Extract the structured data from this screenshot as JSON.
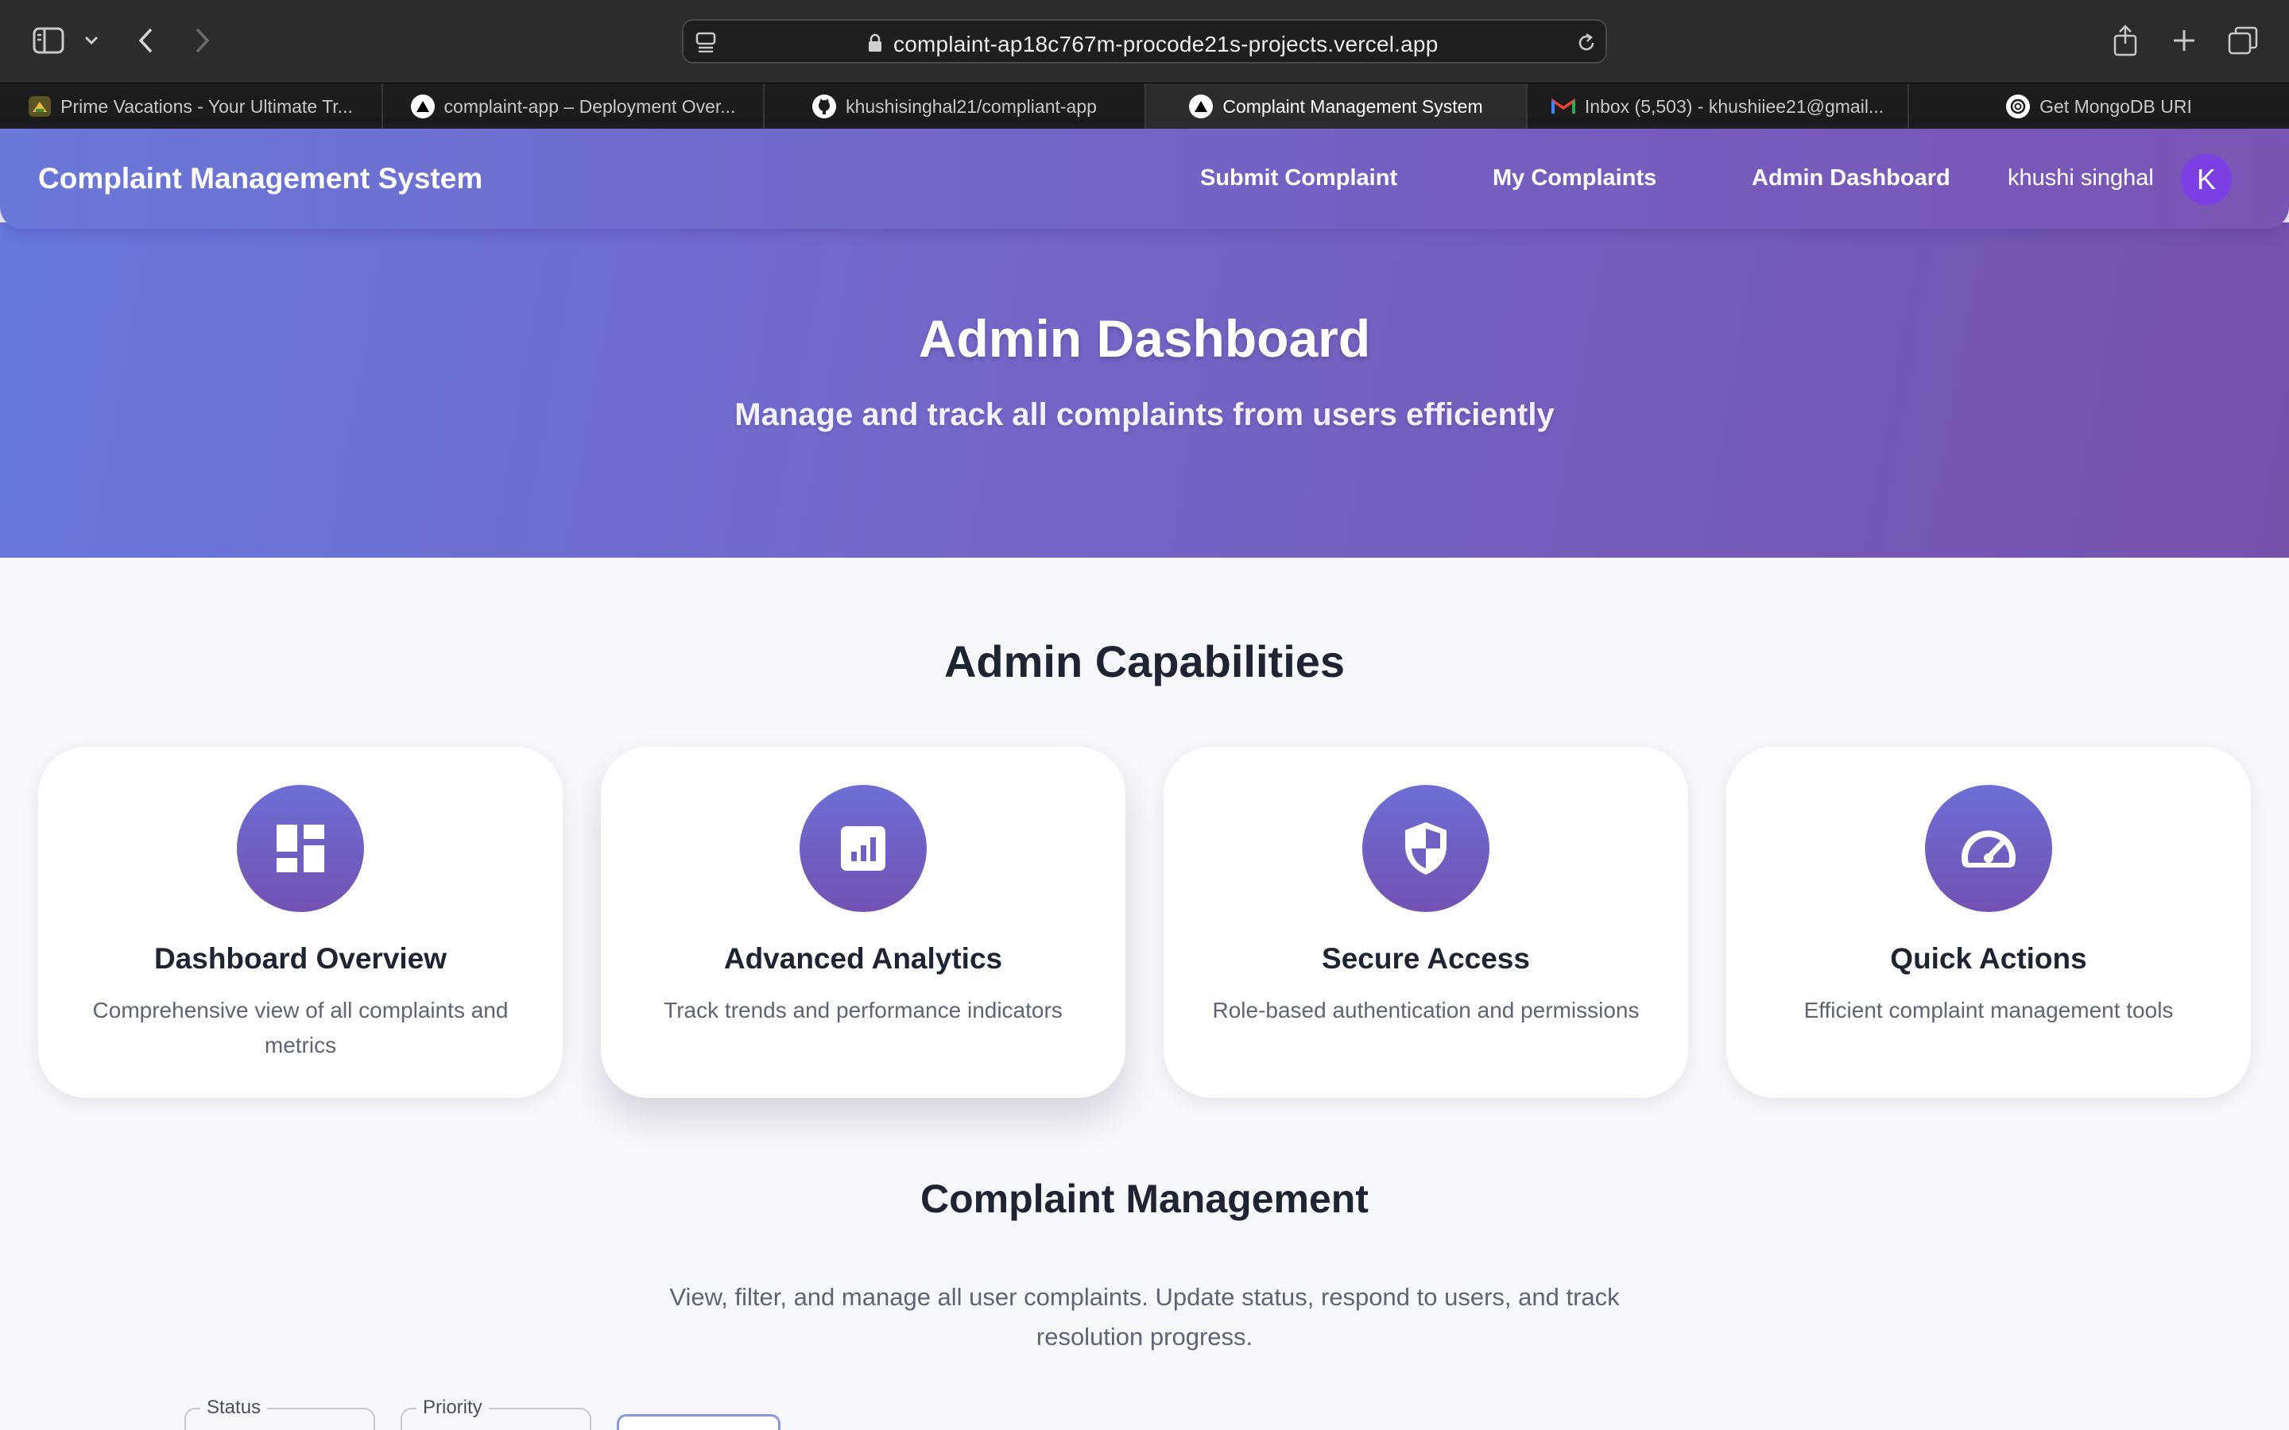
{
  "browser": {
    "url": "complaint-ap18c767m-procode21s-projects.vercel.app",
    "tabs": [
      {
        "title": "Prime Vacations - Your Ultimate Tr...",
        "icon": "prime-vacations-icon"
      },
      {
        "title": "complaint-app – Deployment Over...",
        "icon": "vercel-icon"
      },
      {
        "title": "khushisinghal21/compliant-app",
        "icon": "github-icon"
      },
      {
        "title": "Complaint Management System",
        "icon": "vercel-icon",
        "active": true
      },
      {
        "title": "Inbox (5,503) - khushiiee21@gmail...",
        "icon": "gmail-icon"
      },
      {
        "title": "Get MongoDB URI",
        "icon": "openai-icon"
      }
    ]
  },
  "nav": {
    "brand": "Complaint Management System",
    "links": [
      "Submit Complaint",
      "My Complaints",
      "Admin Dashboard"
    ],
    "user_name": "khushi singhal",
    "avatar_initial": "K"
  },
  "hero": {
    "title": "Admin Dashboard",
    "subtitle": "Manage and track all complaints from users efficiently"
  },
  "capabilities": {
    "title": "Admin Capabilities",
    "cards": [
      {
        "title": "Dashboard Overview",
        "description": "Comprehensive view of all complaints and metrics",
        "icon": "dashboard-icon"
      },
      {
        "title": "Advanced Analytics",
        "description": "Track trends and performance indicators",
        "icon": "analytics-icon"
      },
      {
        "title": "Secure Access",
        "description": "Role-based authentication and permissions",
        "icon": "shield-icon"
      },
      {
        "title": "Quick Actions",
        "description": "Efficient complaint management tools",
        "icon": "speedometer-icon"
      }
    ]
  },
  "management": {
    "title": "Complaint Management",
    "description": "View, filter, and manage all user complaints. Update status, respond to users, and track resolution progress.",
    "filters": {
      "status_label": "Status",
      "priority_label": "Priority"
    }
  },
  "colors": {
    "gradient_start": "#6a78d8",
    "gradient_end": "#7652ad",
    "avatar": "#7b3fe4"
  }
}
